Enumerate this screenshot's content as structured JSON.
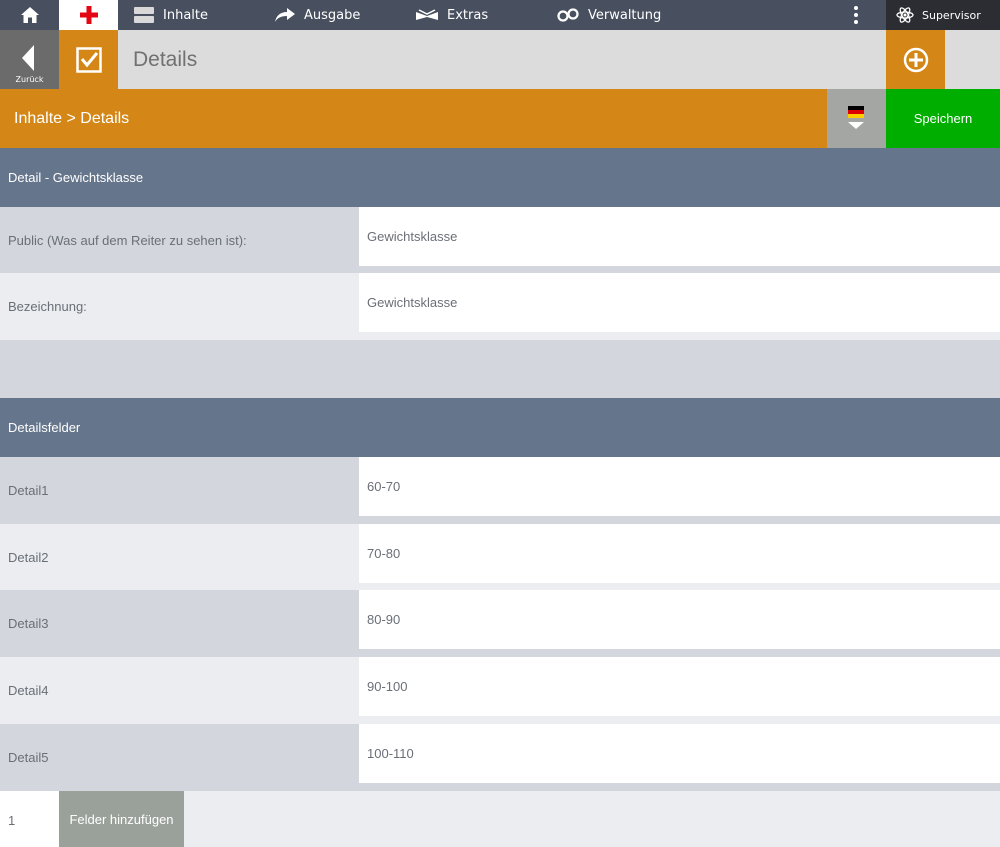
{
  "nav": {
    "items": [
      {
        "label": "Inhalte",
        "icon": "content-icon"
      },
      {
        "label": "Ausgabe",
        "icon": "share-arrow-icon"
      },
      {
        "label": "Extras",
        "icon": "extras-icon"
      },
      {
        "label": "Verwaltung",
        "icon": "gears-icon"
      }
    ],
    "user": "Supervisor"
  },
  "header": {
    "back_label": "Zurück",
    "title": "Details"
  },
  "breadcrumb": "Inhalte > Details",
  "save_label": "Speichern",
  "language_flag": "de",
  "colors": {
    "accent_orange": "#d48716",
    "save_green": "#00ae00",
    "section_header": "#65758b",
    "topbar": "#48505f"
  },
  "section1": {
    "title": "Detail - Gewichtsklasse",
    "rows": [
      {
        "label": "Public (Was auf dem Reiter zu sehen ist):",
        "value": "Gewichtsklasse"
      },
      {
        "label": "Bezeichnung:",
        "value": "Gewichtsklasse"
      }
    ]
  },
  "section2": {
    "title": "Detailsfelder",
    "rows": [
      {
        "label": "Detail1",
        "value": "60-70"
      },
      {
        "label": "Detail2",
        "value": "70-80"
      },
      {
        "label": "Detail3",
        "value": "80-90"
      },
      {
        "label": "Detail4",
        "value": "90-100"
      },
      {
        "label": "Detail5",
        "value": "100-110"
      }
    ]
  },
  "footer": {
    "field_count": "1",
    "add_fields_label": "Felder hinzufügen"
  }
}
